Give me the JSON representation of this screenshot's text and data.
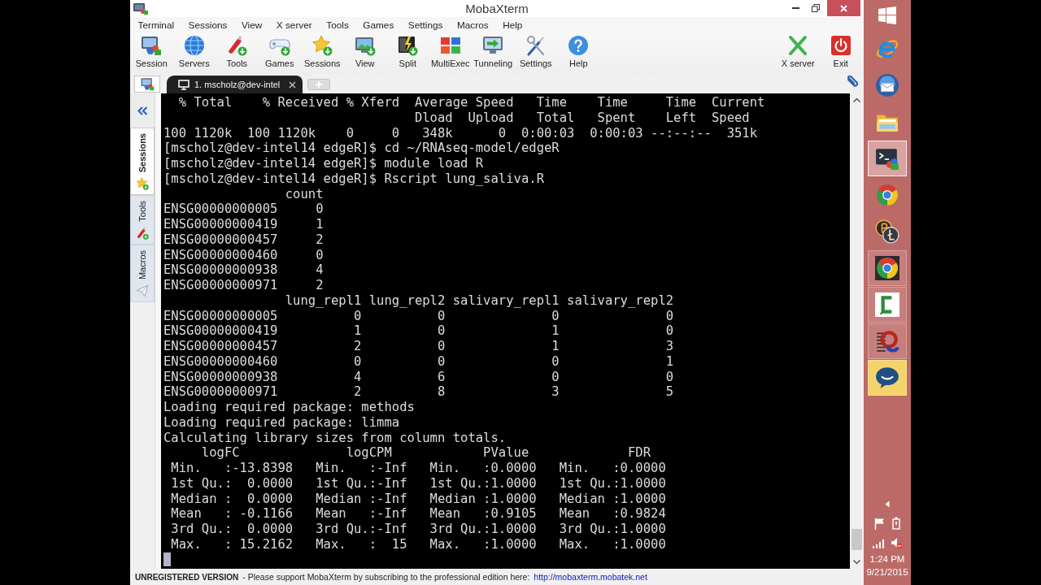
{
  "window": {
    "title": "MobaXterm"
  },
  "menu": [
    "Terminal",
    "Sessions",
    "View",
    "X server",
    "Tools",
    "Games",
    "Settings",
    "Macros",
    "Help"
  ],
  "toolbar": {
    "left": [
      {
        "label": "Session",
        "kind": "session"
      },
      {
        "label": "Servers",
        "kind": "servers"
      },
      {
        "label": "Tools",
        "kind": "tools"
      },
      {
        "label": "Games",
        "kind": "games"
      },
      {
        "label": "Sessions",
        "kind": "sessions"
      },
      {
        "label": "View",
        "kind": "view"
      },
      {
        "label": "Split",
        "kind": "split"
      },
      {
        "label": "MultiExec",
        "kind": "multiexec"
      },
      {
        "label": "Tunneling",
        "kind": "tunneling"
      },
      {
        "label": "Settings",
        "kind": "settings"
      },
      {
        "label": "Help",
        "kind": "help"
      }
    ],
    "right": [
      {
        "label": "X server",
        "kind": "xserver"
      },
      {
        "label": "Exit",
        "kind": "exit"
      }
    ]
  },
  "tabs": [
    {
      "kind": "home",
      "selected": false
    },
    {
      "kind": "terminal",
      "label": "1. mscholz@dev-intel",
      "selected": true
    },
    {
      "kind": "new",
      "selected": false
    }
  ],
  "side_tabs": [
    {
      "label": "Sessions",
      "kind": "sessions",
      "selected": true
    },
    {
      "label": "Tools",
      "kind": "tools",
      "selected": false
    },
    {
      "label": "Macros",
      "kind": "macros",
      "selected": false
    }
  ],
  "terminal": {
    "lines": [
      "  % Total    % Received % Xferd  Average Speed   Time    Time     Time  Current",
      "                                 Dload  Upload   Total   Spent    Left  Speed",
      "100 1120k  100 1120k    0     0   348k      0  0:00:03  0:00:03 --:--:--  351k",
      "[mscholz@dev-intel14 edgeR]$ cd ~/RNAseq-model/edgeR",
      "[mscholz@dev-intel14 edgeR]$ module load R",
      "[mscholz@dev-intel14 edgeR]$ Rscript lung_saliva.R",
      "                count",
      "ENSG00000000005     0",
      "ENSG00000000419     1",
      "ENSG00000000457     2",
      "ENSG00000000460     0",
      "ENSG00000000938     4",
      "ENSG00000000971     2",
      "                lung_repl1 lung_repl2 salivary_repl1 salivary_repl2",
      "ENSG00000000005          0          0              0              0",
      "ENSG00000000419          1          0              1              0",
      "ENSG00000000457          2          0              1              3",
      "ENSG00000000460          0          0              0              1",
      "ENSG00000000938          4          6              0              0",
      "ENSG00000000971          2          8              3              5",
      "Loading required package: methods",
      "Loading required package: limma",
      "Calculating library sizes from column totals.",
      "     logFC              logCPM            PValue             FDR",
      " Min.   :-13.8398   Min.   :-Inf   Min.   :0.0000   Min.   :0.0000",
      " 1st Qu.:  0.0000   1st Qu.:-Inf   1st Qu.:1.0000   1st Qu.:1.0000",
      " Median :  0.0000   Median :-Inf   Median :1.0000   Median :1.0000",
      " Mean   : -0.1166   Mean   :-Inf   Mean   :0.9105   Mean   :0.9824",
      " 3rd Qu.:  0.0000   3rd Qu.:-Inf   3rd Qu.:1.0000   3rd Qu.:1.0000",
      " Max.   : 15.2162   Max.   :  15   Max.   :1.0000   Max.   :1.0000"
    ],
    "cursor_visible": true
  },
  "status_bar": {
    "notice": "UNREGISTERED VERSION",
    "message": "- Please support MobaXterm by subscribing to the professional edition here:",
    "link": "http://mobaxterm.mobatek.net"
  },
  "taskbar": {
    "apps": [
      {
        "kind": "ie",
        "running": false,
        "selected": false,
        "flashing": false
      },
      {
        "kind": "mail",
        "running": false,
        "selected": false,
        "flashing": false
      },
      {
        "kind": "folder",
        "running": false,
        "selected": false,
        "flashing": false
      },
      {
        "kind": "terminal",
        "running": true,
        "selected": true,
        "flashing": false
      },
      {
        "kind": "chrome",
        "running": false,
        "selected": false,
        "flashing": false
      },
      {
        "kind": "coins",
        "running": false,
        "selected": false,
        "flashing": false
      },
      {
        "kind": "chrome-tile",
        "running": true,
        "selected": false,
        "flashing": false
      },
      {
        "kind": "bracket",
        "running": true,
        "selected": false,
        "flashing": false
      },
      {
        "kind": "lines",
        "running": true,
        "selected": false,
        "flashing": false
      },
      {
        "kind": "chat",
        "running": true,
        "selected": false,
        "flashing": true
      }
    ],
    "time": "1:24 PM",
    "date": "9/21/2015"
  }
}
